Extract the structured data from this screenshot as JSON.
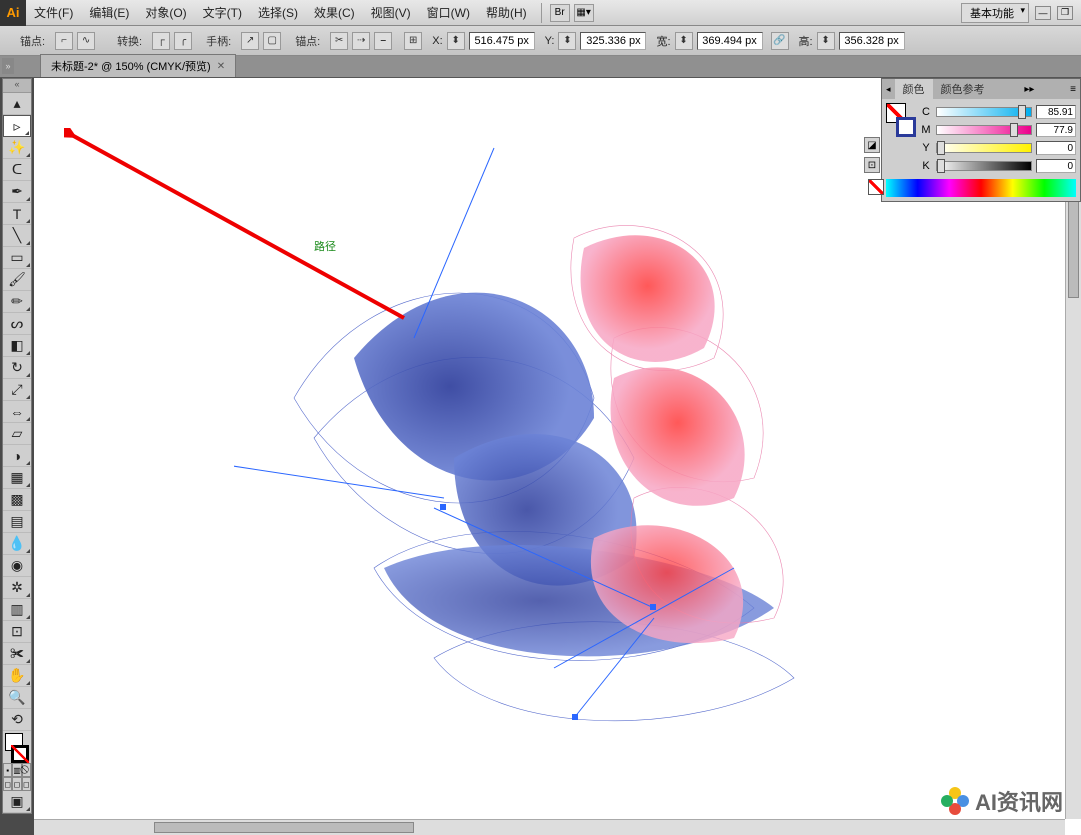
{
  "app_logo": "Ai",
  "menu": {
    "file": "文件(F)",
    "edit": "编辑(E)",
    "object": "对象(O)",
    "type": "文字(T)",
    "select": "选择(S)",
    "effect": "效果(C)",
    "view": "视图(V)",
    "window": "窗口(W)",
    "help": "帮助(H)"
  },
  "menubar_right": {
    "workspace": "基本功能",
    "br_label": "Br"
  },
  "options": {
    "anchor_label": "锚点:",
    "transform_label": "转换:",
    "handle_label": "手柄:",
    "anchor2_label": "锚点:",
    "x_label": "X:",
    "x_value": "516.475 px",
    "y_label": "Y:",
    "y_value": "325.336 px",
    "w_label": "宽:",
    "w_value": "369.494 px",
    "h_label": "高:",
    "h_value": "356.328 px"
  },
  "tab": {
    "title": "未标题-2* @ 150% (CMYK/预览)"
  },
  "canvas": {
    "path_label": "路径"
  },
  "color_panel": {
    "tab_color": "颜色",
    "tab_guide": "颜色参考",
    "channels": [
      {
        "ch": "C",
        "value": "85.91",
        "pct": 86
      },
      {
        "ch": "M",
        "value": "77.9",
        "pct": 78
      },
      {
        "ch": "Y",
        "value": "0",
        "pct": 0
      },
      {
        "ch": "K",
        "value": "0",
        "pct": 0
      }
    ]
  },
  "watermark": {
    "text": "AI资讯网"
  }
}
